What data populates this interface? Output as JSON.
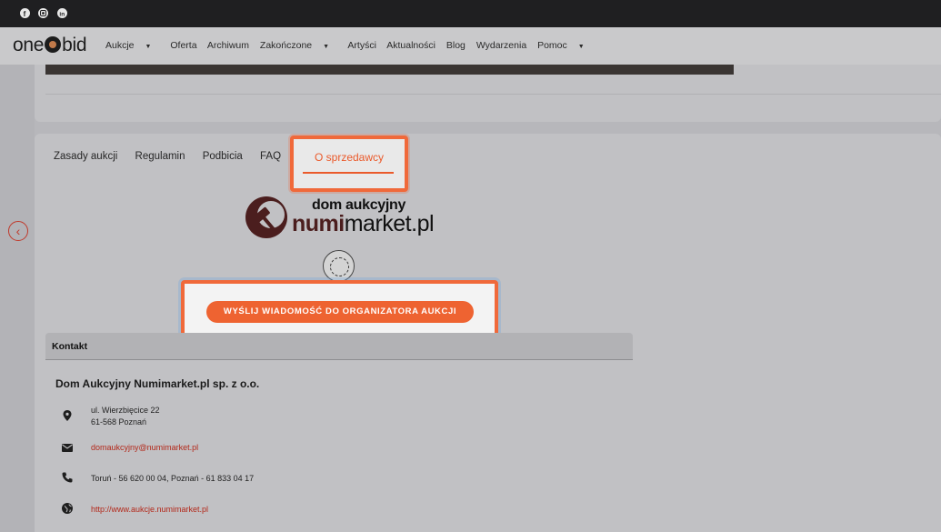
{
  "social_icons": [
    "facebook-icon",
    "instagram-icon",
    "linkedin-icon"
  ],
  "brand": {
    "part1": "one",
    "part2": "bid"
  },
  "nav": {
    "items": [
      {
        "label": "Aukcje",
        "dropdown": true
      },
      {
        "label": "Oferta",
        "dropdown": false
      },
      {
        "label": "Archiwum",
        "dropdown": false
      },
      {
        "label": "Zakończone",
        "dropdown": true
      },
      {
        "label": "Artyści",
        "dropdown": false
      },
      {
        "label": "Aktualności",
        "dropdown": false
      },
      {
        "label": "Blog",
        "dropdown": false
      },
      {
        "label": "Wydarzenia",
        "dropdown": false
      },
      {
        "label": "Pomoc",
        "dropdown": true
      }
    ]
  },
  "tabs": {
    "items": [
      "Zasady aukcji",
      "Regulamin",
      "Podbicia",
      "FAQ"
    ],
    "active": "O sprzedawcy"
  },
  "seller_logo": {
    "top": "dom aukcyjny",
    "bold": "numi",
    "rest": "market.pl"
  },
  "cta": {
    "label": "WYŚLIJ WIADOMOŚĆ DO ORGANIZATORA AUKCJI"
  },
  "contact": {
    "heading": "Kontakt",
    "company": "Dom Aukcyjny Numimarket.pl sp. z o.o.",
    "address_line1": "ul. Wierzbięcice 22",
    "address_line2": "61-568 Poznań",
    "email": "domaukcyjny@numimarket.pl",
    "phone": "Toruń - 56 620 00 04, Poznań - 61 833 04 17",
    "website": "http://www.aukcje.numimarket.pl"
  },
  "colors": {
    "accent": "#ee6331",
    "link": "#b3281a"
  }
}
